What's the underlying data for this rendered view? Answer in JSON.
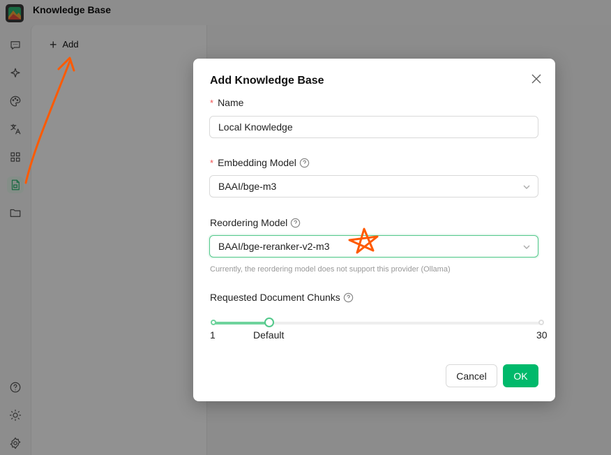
{
  "app": {
    "title": "Knowledge Base"
  },
  "sidebar": {
    "top_icons": [
      "chat-icon",
      "sparkle-icon",
      "palette-icon",
      "translate-icon",
      "apps-grid-icon",
      "knowledge-base-icon",
      "folder-icon"
    ],
    "bottom_icons": [
      "help-icon",
      "theme-icon",
      "settings-icon"
    ],
    "active": "knowledge-base-icon"
  },
  "list": {
    "add_label": "Add"
  },
  "modal": {
    "title": "Add Knowledge Base",
    "name": {
      "label": "Name",
      "value": "Local Knowledge"
    },
    "embedding": {
      "label": "Embedding Model",
      "value": "BAAI/bge-m3"
    },
    "reorder": {
      "label": "Reordering Model",
      "value": "BAAI/bge-reranker-v2-m3",
      "hint": "Currently, the reordering model does not support this provider (Ollama)"
    },
    "chunks": {
      "label": "Requested Document Chunks",
      "min_label": "1",
      "default_label": "Default",
      "max_label": "30",
      "min": 1,
      "max": 30,
      "value": 6
    },
    "cancel_label": "Cancel",
    "ok_label": "OK"
  },
  "colors": {
    "accent": "#00b96b",
    "annotation": "#ff5a00"
  }
}
